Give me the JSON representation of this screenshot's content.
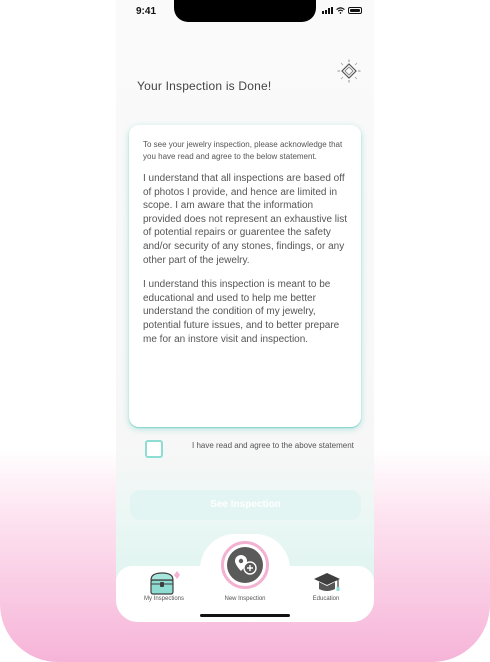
{
  "status_bar": {
    "time": "9:41"
  },
  "page": {
    "title": "Your Inspection is Done!"
  },
  "statement": {
    "intro": "To see your jewelry inspection, please acknowledge that you have read and agree to the below statement.",
    "paragraph_1": "I understand that all inspections are based off of photos I provide, and hence are limited in scope. I am aware that the information provided does not represent an exhaustive list of potential repairs or guarentee the safety and/or security of any stones, findings, or any other part of the jewelry.",
    "paragraph_2": "I understand this inspection is meant to be educational and used to help me better understand the condition of my jewelry, potential future issues, and to better prepare me for an instore visit and inspection."
  },
  "agreement": {
    "label": "I have read and agree to the above statement",
    "checked": false
  },
  "actions": {
    "see_inspection_label": "See Inspection",
    "enabled": false
  },
  "tab_bar": {
    "items": [
      {
        "label": "My Inspections",
        "icon": "treasure-chest-icon"
      },
      {
        "label": "New Inspection",
        "icon": "add-location-icon"
      },
      {
        "label": "Education",
        "icon": "graduation-cap-icon"
      }
    ]
  },
  "colors": {
    "accent": "#8fdcd2",
    "pink": "#f3b2d2",
    "text": "#555555"
  }
}
